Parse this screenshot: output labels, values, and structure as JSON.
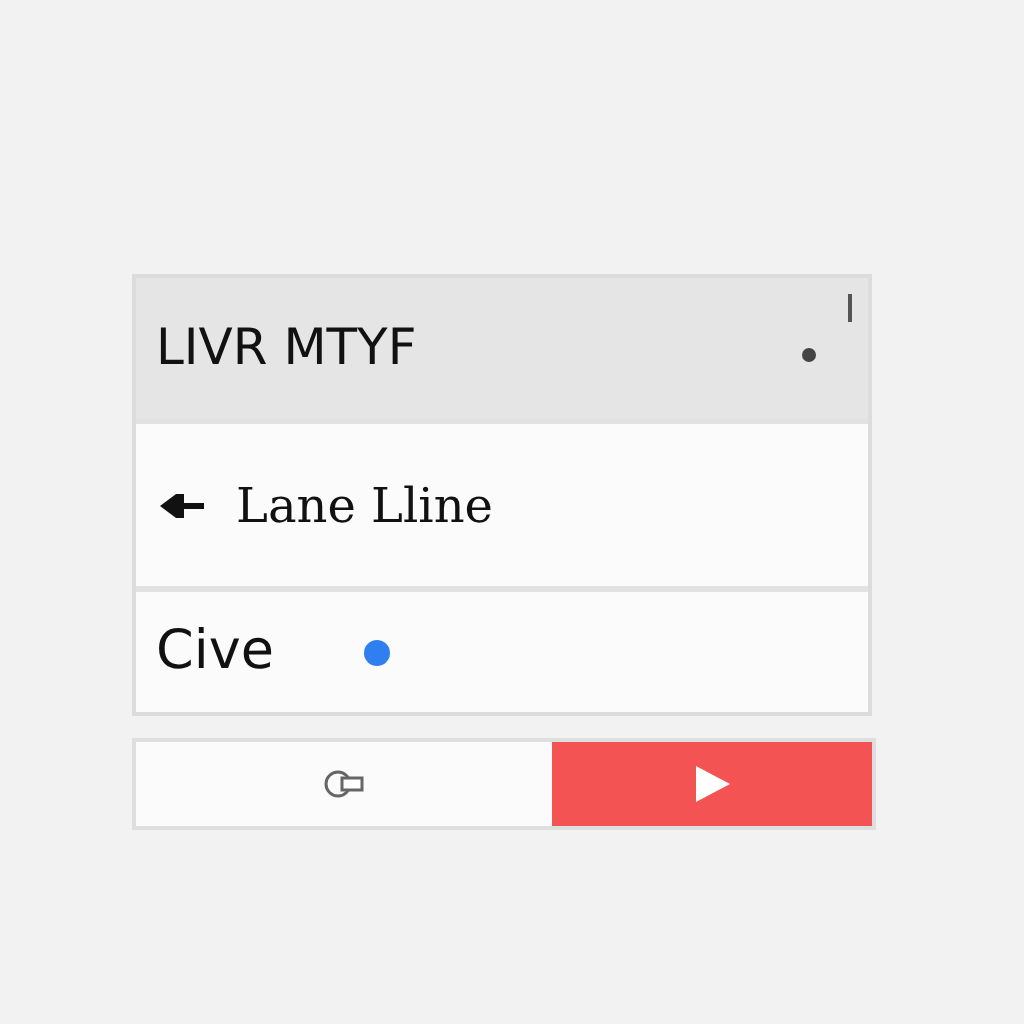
{
  "list": [
    {
      "kind": "header",
      "label": "LIVR MTYF",
      "selected": true
    },
    {
      "kind": "icon",
      "label": "Lane Lline",
      "selected": false
    },
    {
      "kind": "status",
      "label": "Cive",
      "selected": false,
      "color": "#2f7ff0"
    }
  ]
}
